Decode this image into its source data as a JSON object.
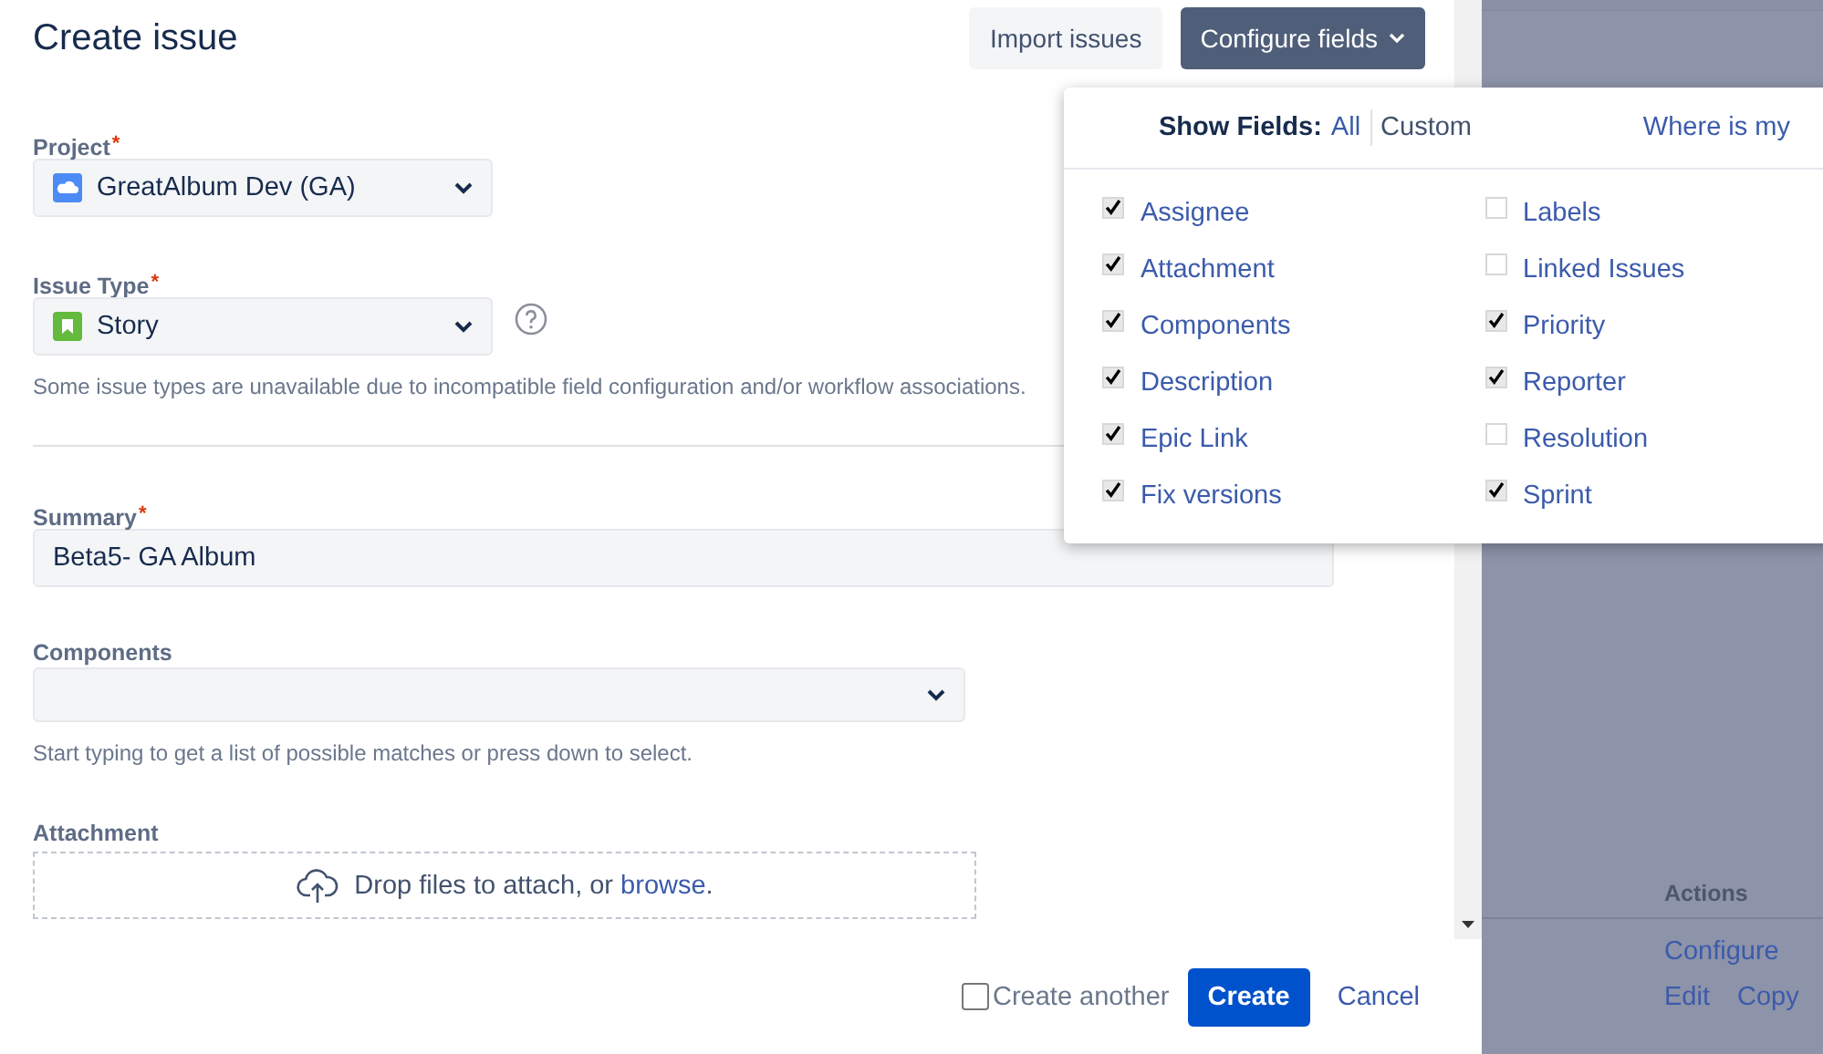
{
  "dialog": {
    "title": "Create issue",
    "header_buttons": [
      {
        "label": "Import issues",
        "kind": "plain"
      },
      {
        "label": "Configure fields",
        "kind": "dropdown"
      }
    ]
  },
  "form": {
    "project": {
      "label": "Project",
      "required": true,
      "value": "GreatAlbum Dev (GA)"
    },
    "issue_type": {
      "label": "Issue Type",
      "required": true,
      "value": "Story",
      "help": "Some issue types are unavailable due to incompatible field configuration and/or workflow associations."
    },
    "summary": {
      "label": "Summary",
      "required": true,
      "value": "Beta5- GA Album"
    },
    "components": {
      "label": "Components",
      "required": false,
      "help": "Start typing to get a list of possible matches or press down to select."
    },
    "attachment": {
      "label": "Attachment",
      "required": false,
      "drop_text": "Drop files to attach, or ",
      "browse_link": "browse",
      "drop_end": "."
    }
  },
  "footer": {
    "create_another": {
      "label": "Create another",
      "checked": false
    },
    "create_button": "Create",
    "cancel_link": "Cancel"
  },
  "configure_popup": {
    "show_fields_label": "Show Fields:",
    "modes": [
      {
        "label": "All",
        "selected": false
      },
      {
        "label": "Custom",
        "selected": true
      }
    ],
    "help_link": "Where is my",
    "columns": [
      [
        {
          "label": "Assignee",
          "checked": true
        },
        {
          "label": "Attachment",
          "checked": true
        },
        {
          "label": "Components",
          "checked": true
        },
        {
          "label": "Description",
          "checked": true
        },
        {
          "label": "Epic Link",
          "checked": true
        },
        {
          "label": "Fix versions",
          "checked": true
        }
      ],
      [
        {
          "label": "Labels",
          "checked": false
        },
        {
          "label": "Linked Issues",
          "checked": false
        },
        {
          "label": "Priority",
          "checked": true
        },
        {
          "label": "Reporter",
          "checked": true
        },
        {
          "label": "Resolution",
          "checked": false
        },
        {
          "label": "Sprint",
          "checked": true
        }
      ]
    ]
  },
  "required_mark": "*",
  "background": {
    "actions_heading": "Actions",
    "actions": [
      [
        "Configure"
      ],
      [
        "Edit",
        "Copy"
      ]
    ]
  }
}
